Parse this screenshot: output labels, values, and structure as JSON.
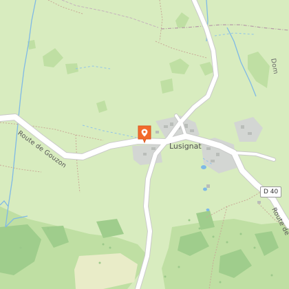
{
  "map": {
    "labels": {
      "road_gouzon": "Route de Gouzon",
      "village": "Lusignat",
      "road_shield": "D 40",
      "road_right_bottom": "Route de",
      "road_right_top": "Dom"
    },
    "marker": {
      "icon": "map-pin-icon",
      "color": "#f26a2c"
    },
    "colors": {
      "grass": "#d8ecbf",
      "forest": "#bfdfa3",
      "forest_dark": "#9fcd8c",
      "road": "#ffffff",
      "road_casing": "#c9c9c9",
      "water": "#7fb9e6",
      "built": "#d3d6d3",
      "path": "#b89a86",
      "boundary": "#a08090"
    }
  }
}
